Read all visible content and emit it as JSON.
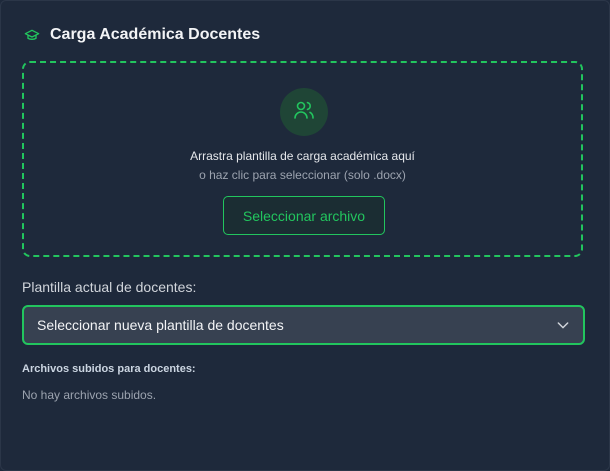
{
  "header": {
    "title": "Carga Académica Docentes",
    "icon": "graduation-cap-icon"
  },
  "dropzone": {
    "icon": "users-icon",
    "primary_text": "Arrastra plantilla de carga académica aquí",
    "secondary_text": "o haz clic para seleccionar (solo .docx)",
    "button_label": "Seleccionar archivo"
  },
  "template_select": {
    "label": "Plantilla actual de docentes:",
    "value": "Seleccionar nueva plantilla de docentes"
  },
  "uploaded_files": {
    "heading": "Archivos subidos para docentes:",
    "empty_text": "No hay archivos subidos."
  },
  "colors": {
    "accent": "#22c55e",
    "background": "#1e293b",
    "select_bg": "#374151"
  }
}
